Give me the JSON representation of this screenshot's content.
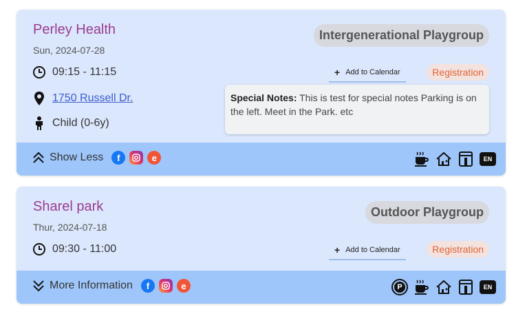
{
  "events": [
    {
      "title": "Perley Health",
      "date": "Sun, 2024-07-28",
      "time": "09:15 - 11:15",
      "address": "1750 Russell Dr.",
      "age": "Child (0-6y)",
      "category": "Intergenerational Playgroup",
      "add_calendar": "Add to Calendar",
      "registration": "Registration",
      "notes_label": "Special Notes:",
      "notes_text": "This is test for special notes Parking is on the left. Meet in the Park. etc",
      "toggle_label": "Show Less",
      "language": "EN"
    },
    {
      "title": "Sharel park",
      "date": "Thur, 2024-07-18",
      "time": "09:30 - 11:00",
      "category": "Outdoor Playgroup",
      "add_calendar": "Add to Calendar",
      "registration": "Registration",
      "toggle_label": "More Information",
      "parking": "P",
      "language": "EN"
    }
  ],
  "icons": {
    "facebook": "f",
    "eventbrite": "e"
  }
}
